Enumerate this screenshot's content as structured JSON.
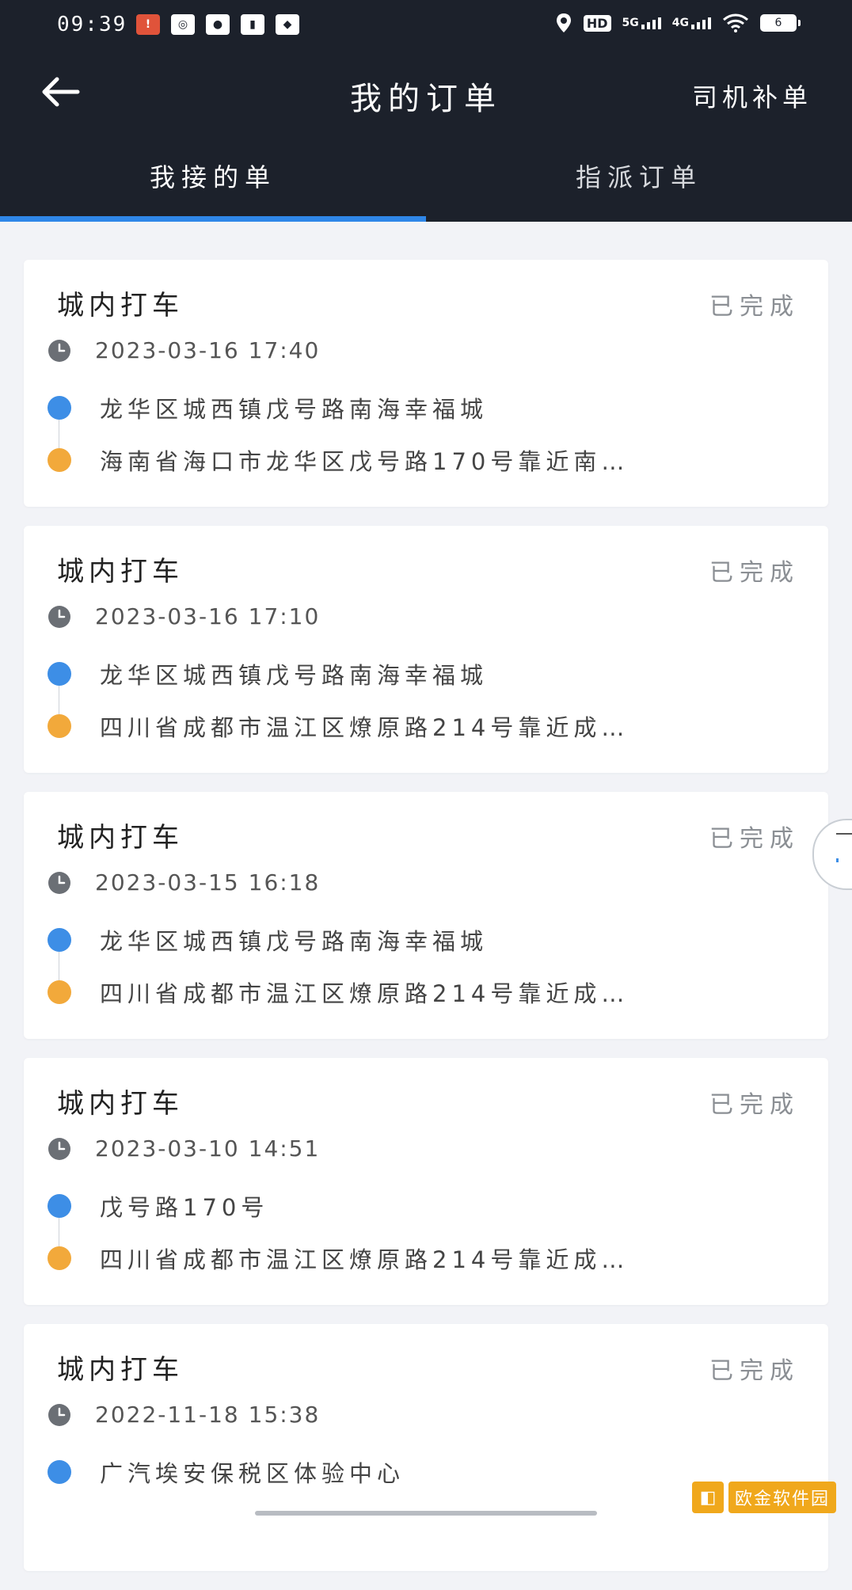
{
  "status_bar": {
    "time": "09:39",
    "app_icons": [
      "notification-icon",
      "weibo-icon",
      "wechat-icon",
      "iqiyi-icon",
      "taobao-icon"
    ],
    "right_icons": [
      "location-icon",
      "hd-icon",
      "5g-signal-icon",
      "4g-signal-icon",
      "wifi-icon",
      "battery-icon"
    ],
    "hd_label": "HD",
    "net_5g": "5G",
    "net_4g": "4G",
    "battery_level": "6"
  },
  "header": {
    "back_icon": "arrow-left-icon",
    "title": "我的订单",
    "action_label": "司机补单"
  },
  "tabs": [
    {
      "label": "我接的单",
      "active": true
    },
    {
      "label": "指派订单",
      "active": false
    }
  ],
  "colors": {
    "header_bg": "#1c212b",
    "tab_indicator": "#2f87e8",
    "start_dot": "#3d8ee6",
    "end_dot": "#f2a93b",
    "page_bg": "#f2f3f7"
  },
  "orders": [
    {
      "type": "城内打车",
      "status": "已完成",
      "time": "2023-03-16 17:40",
      "start": "龙华区城西镇戊号路南海幸福城",
      "end": "海南省海口市龙华区戊号路170号靠近南…"
    },
    {
      "type": "城内打车",
      "status": "已完成",
      "time": "2023-03-16 17:10",
      "start": "龙华区城西镇戊号路南海幸福城",
      "end": "四川省成都市温江区燎原路214号靠近成…"
    },
    {
      "type": "城内打车",
      "status": "已完成",
      "time": "2023-03-15 16:18",
      "start": "龙华区城西镇戊号路南海幸福城",
      "end": "四川省成都市温江区燎原路214号靠近成…"
    },
    {
      "type": "城内打车",
      "status": "已完成",
      "time": "2023-03-10 14:51",
      "start": "戊号路170号",
      "end": "四川省成都市温江区燎原路214号靠近成…"
    },
    {
      "type": "城内打车",
      "status": "已完成",
      "time": "2022-11-18 15:38",
      "start": "广汽埃安保税区体验中心"
    }
  ],
  "watermark": {
    "text": "欧金软件园"
  }
}
